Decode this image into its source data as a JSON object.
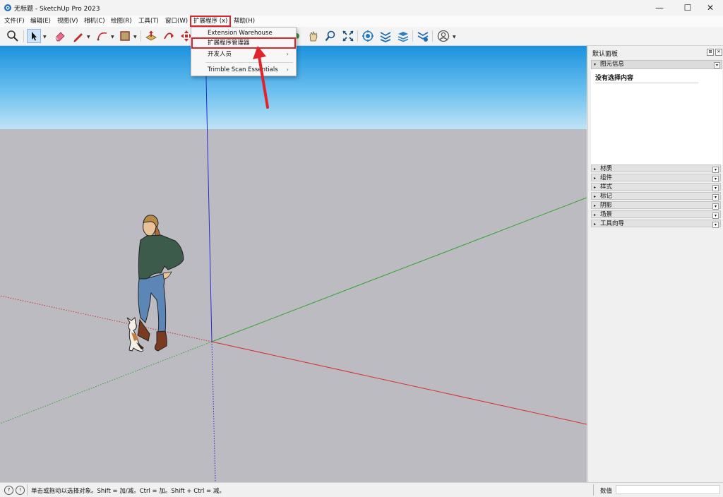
{
  "window": {
    "title": "无标题 - SketchUp Pro 2023",
    "minimize": "—",
    "maximize": "☐",
    "close": "✕"
  },
  "menubar": {
    "items": [
      "文件(F)",
      "编辑(E)",
      "视图(V)",
      "相机(C)",
      "绘图(R)",
      "工具(T)",
      "窗口(W)",
      "扩展程序 (x)",
      "帮助(H)"
    ],
    "highlighted": "扩展程序 (x)"
  },
  "toolbar": {
    "icons": [
      "zoom-extents-icon",
      "select-arrow-icon",
      "eraser-icon",
      "pencil-line-icon",
      "arc-icon",
      "shape-rectangle-icon",
      "push-pull-icon",
      "move-icon",
      "rotate-icon",
      "orbit-icon",
      "pan-icon",
      "zoom-icon",
      "zoom-window-icon",
      "extension-warehouse-icon",
      "section-plane-icon",
      "layers-icon",
      "trimble-connect-icon",
      "account-icon"
    ]
  },
  "dropdown": {
    "items": [
      {
        "label": "Extension Warehouse",
        "submenu": false
      },
      {
        "label": "扩展程序管理器",
        "submenu": false,
        "highlighted": true
      },
      {
        "label": "开发人员",
        "submenu": true
      },
      {
        "label": "Trimble Scan Essentials",
        "submenu": true
      }
    ],
    "submenu_arrow": "›"
  },
  "panel": {
    "title": "默认面板",
    "pin": "⊞",
    "close": "✕",
    "entity_info": {
      "label": "图元信息",
      "body_text": "没有选择内容"
    },
    "sections": [
      "材质",
      "组件",
      "样式",
      "标记",
      "阴影",
      "场景",
      "工具向导"
    ],
    "expand_glyph": "▸",
    "collapse_glyph": "▾"
  },
  "statusbar": {
    "text": "单击或拖动以选择对象。Shift = 加/减。Ctrl = 加。Shift + Ctrl = 减。",
    "measurements_label": "数值",
    "geo_icon": "?",
    "info_icon": "!"
  },
  "colors": {
    "red_axis": "#d43030",
    "green_axis": "#2fa52f",
    "blue_axis": "#2a2acf",
    "highlight_box": "#e0242b",
    "sky_top": "#1b92de",
    "ground": "#bcbbc1"
  }
}
